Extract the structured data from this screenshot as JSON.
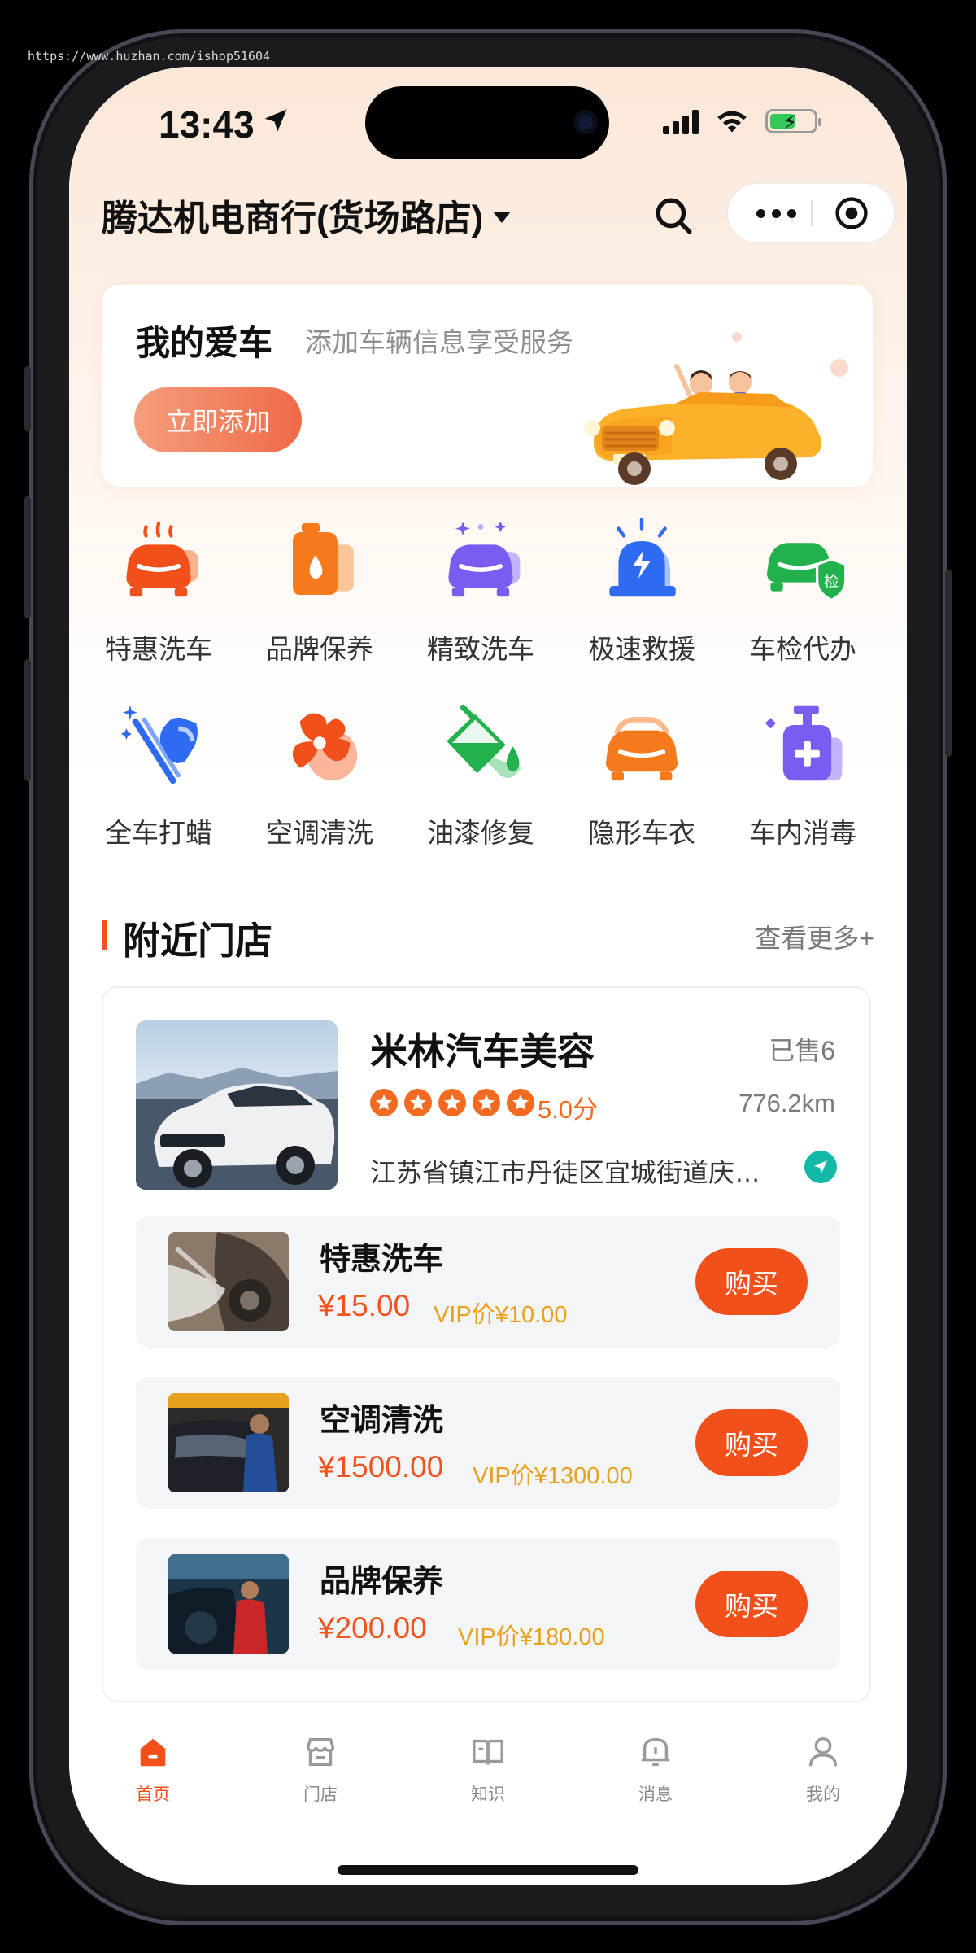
{
  "watermark": "https://www.huzhan.com/ishop51604",
  "status_bar": {
    "time": "13:43"
  },
  "header": {
    "store_title": "腾达机电商行(货场路店)"
  },
  "my_car": {
    "title": "我的爱车",
    "subtitle": "添加车辆信息享受服务",
    "add_button": "立即添加"
  },
  "services": [
    {
      "label": "特惠洗车",
      "icon": "car-wash-icon",
      "color": "#f2501a"
    },
    {
      "label": "品牌保养",
      "icon": "oil-can-icon",
      "color": "#f47a1c"
    },
    {
      "label": "精致洗车",
      "icon": "sparkle-car-icon",
      "color": "#7b5cf0"
    },
    {
      "label": "极速救援",
      "icon": "rescue-siren-icon",
      "color": "#2f6bf2"
    },
    {
      "label": "车检代办",
      "icon": "inspection-car-icon",
      "color": "#22b14c"
    },
    {
      "label": "全车打蜡",
      "icon": "wax-spray-icon",
      "color": "#2f6bf2"
    },
    {
      "label": "空调清洗",
      "icon": "fan-icon",
      "color": "#f2501a"
    },
    {
      "label": "油漆修复",
      "icon": "paint-bucket-icon",
      "color": "#22b14c"
    },
    {
      "label": "隐形车衣",
      "icon": "car-film-icon",
      "color": "#f47a1c"
    },
    {
      "label": "车内消毒",
      "icon": "sanitizer-icon",
      "color": "#7b5cf0"
    }
  ],
  "nearby": {
    "title": "附近门店",
    "more": "查看更多+",
    "store": {
      "name": "米林汽车美容",
      "sold": "已售6",
      "rating": "5.0分",
      "stars": 5,
      "distance": "776.2km",
      "address": "江苏省镇江市丹徒区宜城街道庆…"
    },
    "items": [
      {
        "name": "特惠洗车",
        "price": "¥15.00",
        "vip": "VIP价¥10.00",
        "buy": "购买"
      },
      {
        "name": "空调清洗",
        "price": "¥1500.00",
        "vip": "VIP价¥1300.00",
        "buy": "购买"
      },
      {
        "name": "品牌保养",
        "price": "¥200.00",
        "vip": "VIP价¥180.00",
        "buy": "购买"
      }
    ]
  },
  "tabbar": [
    {
      "label": "首页",
      "icon": "home-icon",
      "active": true
    },
    {
      "label": "门店",
      "icon": "store-icon",
      "active": false
    },
    {
      "label": "知识",
      "icon": "book-icon",
      "active": false
    },
    {
      "label": "消息",
      "icon": "message-icon",
      "active": false
    },
    {
      "label": "我的",
      "icon": "profile-icon",
      "active": false
    }
  ],
  "colors": {
    "accent": "#f2501a",
    "vip": "#e8a11b",
    "bg_warm": "#fbe7d8"
  }
}
